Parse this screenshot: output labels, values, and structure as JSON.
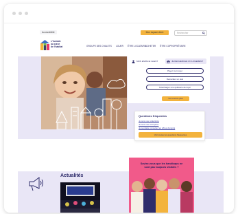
{
  "topbar": {
    "accessibility_label": "Accessibilité",
    "mon_espace_label": "Mon espace client",
    "search_placeholder": "Rechercher"
  },
  "brand": {
    "line1": "L'humain",
    "line2": "au cœur",
    "line3": "de l'habitat"
  },
  "nav": {
    "items": [
      "GROUPE DES CHALETS",
      "LOUER",
      "ÊTRE LOCATAIRE",
      "ACHETER",
      "ÊTRE COPROPRIÉTAIRE"
    ]
  },
  "panel": {
    "tab_client": "MON ESPACE CLIENT",
    "tab_search": "JE RECHERCHE UN LOGEMENT",
    "buttons": [
      "Payer mon loyer",
      "Demander un avis",
      "Télécharger une quittance de loyer"
    ],
    "more_label": "Voir encore plus"
  },
  "faq": {
    "title": "Questions fréquentes",
    "links": [
      "Je suis une collectivité",
      "Je suis une entreprise",
      "Je souhaite consulter les offres d'emploi"
    ],
    "button_label": "Voir toutes les questions fréquentes"
  },
  "news": {
    "title": "Actualités"
  },
  "poster": {
    "line1": "Saviez-vous que les handicaps ne",
    "line2": "sont pas toujours visibles ?"
  },
  "colors": {
    "navy": "#2f2d6b",
    "yellow": "#f3b33d",
    "lavender": "#e9e6f6",
    "pink": "#f15a8a"
  }
}
